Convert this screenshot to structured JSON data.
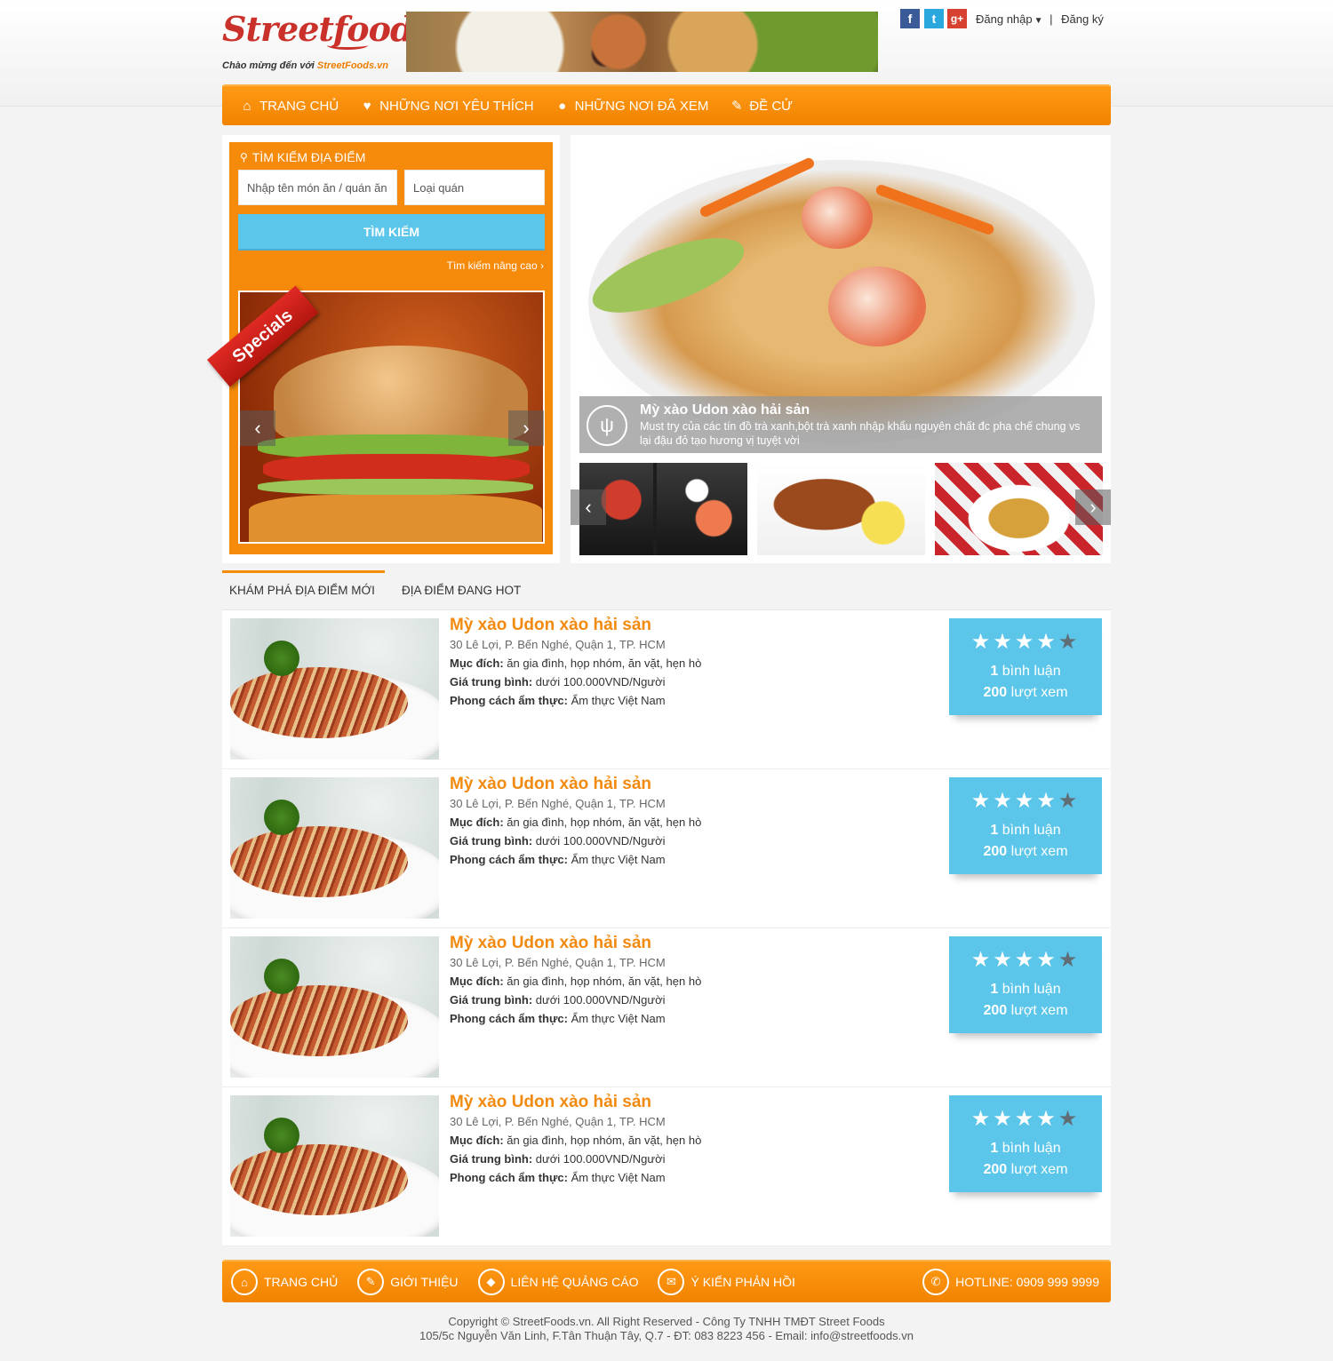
{
  "header": {
    "logo_text": "Streetfoods",
    "tagline_prefix": "Chào mừng đến với",
    "tagline_brand": "StreetFoods.vn",
    "social": [
      "f",
      "t",
      "g+"
    ],
    "login_label": "Đăng nhập",
    "separator": "|",
    "register_label": "Đăng ký"
  },
  "nav": {
    "items": [
      {
        "label": "TRANG CHỦ",
        "icon": "home-icon"
      },
      {
        "label": "NHỮNG NƠI YÊU THÍCH",
        "icon": "heart-icon"
      },
      {
        "label": "NHỮNG NƠI ĐÃ XEM",
        "icon": "map-pin-icon"
      },
      {
        "label": "ĐỀ CỬ",
        "icon": "pencil-icon"
      }
    ]
  },
  "search": {
    "title": "TÌM KIẾM ĐỊA ĐIỂM",
    "dish_placeholder": "Nhập tên món ăn / quán ăn",
    "type_placeholder": "Loại quán",
    "button_label": "TÌM KIẾM",
    "advanced_label": "Tìm kiếm nâng cao"
  },
  "specials": {
    "ribbon_label": "Specials"
  },
  "slider": {
    "caption_title": "Mỳ xào Udon xào hải sản",
    "caption_desc": "Must try của các tín đồ trà xanh,bột trà xanh nhập khẩu nguyên chất đc pha chế chung vs lại đậu đỏ  tạo hương vị tuyệt vời"
  },
  "tabs": [
    {
      "label": "KHÁM PHÁ ĐỊA ĐIỂM MỚI",
      "active": true
    },
    {
      "label": "ĐỊA ĐIỂM ĐANG HOT",
      "active": false
    }
  ],
  "listings": [
    {
      "title": "Mỳ xào Udon xào hải sản",
      "address": "30 Lê Lợi, P. Bến Nghé, Quận 1, TP. HCM",
      "purpose_label": "Mục đích:",
      "purpose": "ăn gia đình, họp nhóm, ăn vặt, hẹn hò",
      "price_label": "Giá trung bình:",
      "price": "dưới 100.000VND/Người",
      "style_label": "Phong cách ẩm thực:",
      "style": "Ẩm thực Việt Nam",
      "stars": 4,
      "comments_count": "1",
      "comments_label": "bình luận",
      "views_count": "200",
      "views_label": "lượt xem"
    },
    {
      "title": "Mỳ xào Udon xào hải sản",
      "address": "30 Lê Lợi, P. Bến Nghé, Quận 1, TP. HCM",
      "purpose_label": "Mục đích:",
      "purpose": "ăn gia đình, họp nhóm, ăn vặt, hẹn hò",
      "price_label": "Giá trung bình:",
      "price": "dưới 100.000VND/Người",
      "style_label": "Phong cách ẩm thực:",
      "style": "Ẩm thực Việt Nam",
      "stars": 4,
      "comments_count": "1",
      "comments_label": "bình luận",
      "views_count": "200",
      "views_label": "lượt xem"
    },
    {
      "title": "Mỳ xào Udon xào hải sản",
      "address": "30 Lê Lợi, P. Bến Nghé, Quận 1, TP. HCM",
      "purpose_label": "Mục đích:",
      "purpose": "ăn gia đình, họp nhóm, ăn vặt, hẹn hò",
      "price_label": "Giá trung bình:",
      "price": "dưới 100.000VND/Người",
      "style_label": "Phong cách ẩm thực:",
      "style": "Ẩm thực Việt Nam",
      "stars": 4,
      "comments_count": "1",
      "comments_label": "bình luận",
      "views_count": "200",
      "views_label": "lượt xem"
    },
    {
      "title": "Mỳ xào Udon xào hải sản",
      "address": "30 Lê Lợi, P. Bến Nghé, Quận 1, TP. HCM",
      "purpose_label": "Mục đích:",
      "purpose": "ăn gia đình, họp nhóm, ăn vặt, hẹn hò",
      "price_label": "Giá trung bình:",
      "price": "dưới 100.000VND/Người",
      "style_label": "Phong cách ẩm thực:",
      "style": "Ẩm thực Việt Nam",
      "stars": 4,
      "comments_count": "1",
      "comments_label": "bình luận",
      "views_count": "200",
      "views_label": "lượt xem"
    }
  ],
  "footer": {
    "items": [
      {
        "label": "TRANG CHỦ",
        "icon": "home-icon"
      },
      {
        "label": "GIỚI THIỆU",
        "icon": "pencil-icon"
      },
      {
        "label": "LIÊN HỆ QUẢNG CÁO",
        "icon": "tag-icon"
      },
      {
        "label": "Ý KIẾN PHẢN HỒI",
        "icon": "mail-icon"
      }
    ],
    "hotline": "HOTLINE: 0909 999 9999",
    "copyright_line1": "Copyright © StreetFoods.vn. All Right Reserved - Công Ty TNHH TMĐT Street Foods",
    "copyright_line2": "105/5c Nguyễn Văn Linh, F.Tân Thuận Tây, Q.7 - ĐT: 083 8223 456 - Email: info@streetfoods.vn"
  },
  "colors": {
    "accent_orange": "#f68a0a",
    "title_orange": "#f28a10",
    "rating_blue": "#5bc6ea",
    "search_blue": "#5bc6ea"
  }
}
